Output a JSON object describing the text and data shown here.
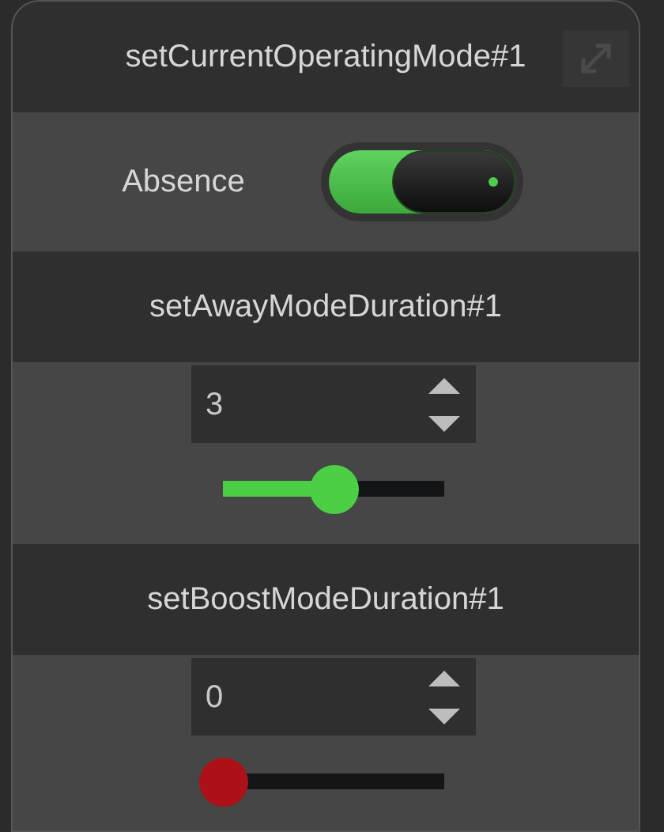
{
  "sections": [
    {
      "kind": "toggle",
      "title": "setCurrentOperatingMode#1",
      "label": "Absence",
      "on": true
    },
    {
      "kind": "number",
      "title": "setAwayModeDuration#1",
      "value": "3",
      "level": 0.5
    },
    {
      "kind": "number",
      "title": "setBoostModeDuration#1",
      "value": "0",
      "level": 0
    }
  ]
}
